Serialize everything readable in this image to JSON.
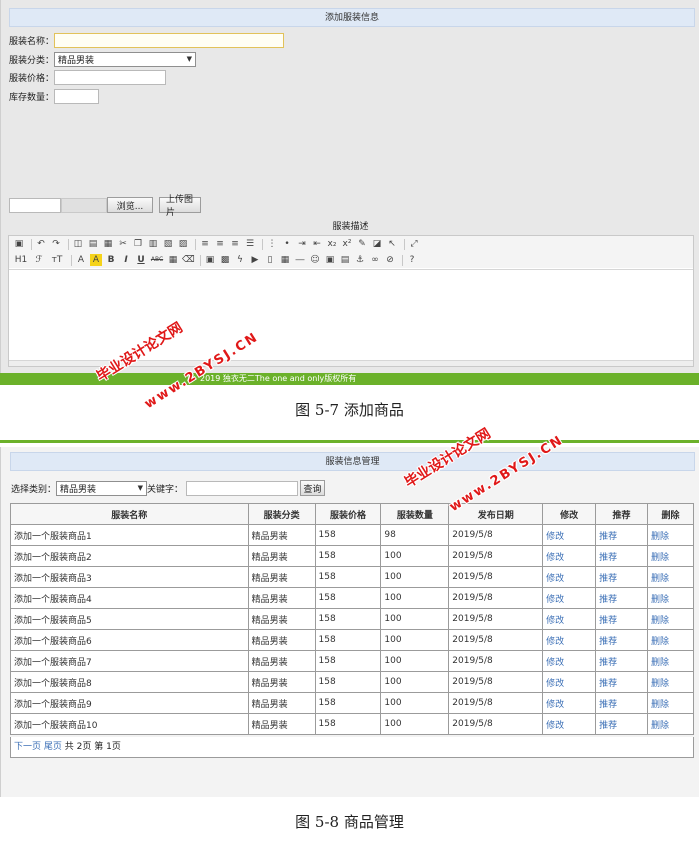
{
  "add_form": {
    "header": "添加服装信息",
    "name_label": "服装名称：",
    "category_label": "服装分类：",
    "category_value": "精品男装",
    "price_label": "服装价格：",
    "stock_label": "库存数量：",
    "browse_button": "浏览...",
    "upload_button": "上传图片",
    "description_label": "服装描述",
    "toolbar_row1": [
      "source-icon",
      "undo-icon",
      "redo-icon",
      "preview-icon",
      "print-icon",
      "template-icon",
      "cut-icon",
      "copy-icon",
      "paste-icon",
      "paste-text-icon",
      "paste-word-icon",
      "align-left-icon",
      "align-center-icon",
      "align-right-icon",
      "justify-icon",
      "ordered-list-icon",
      "unordered-list-icon",
      "indent-icon",
      "outdent-icon",
      "subscript-icon",
      "superscript-icon",
      "clear-format-icon",
      "select-all-icon",
      "fullscreen-icon"
    ],
    "toolbar_row2": [
      "heading-icon",
      "font-family-icon",
      "font-size-icon",
      "font-color-icon",
      "background-color-icon",
      "bold-icon",
      "italic-icon",
      "underline-icon",
      "strikethrough-icon",
      "line-height-icon",
      "remove-format-icon",
      "image-icon",
      "multi-image-icon",
      "flash-icon",
      "media-icon",
      "file-icon",
      "table-icon",
      "hr-icon",
      "emoticon-icon",
      "map-icon",
      "pagebreak-icon",
      "anchor-icon",
      "link-icon",
      "unlink-icon",
      "about-icon"
    ],
    "toolbar_glyphs_row2": {
      "heading": "H1",
      "font_family": "ℱ",
      "font_size": "тT",
      "font_color": "A",
      "bg_color": "A",
      "bold": "B",
      "italic": "I",
      "underline": "U",
      "strike": "ABC"
    }
  },
  "footer": {
    "copyright": "2019 独衣无二The one and only版权所有"
  },
  "captions": {
    "fig1": "图  5-7  添加商品",
    "fig2": "图  5-8  商品管理"
  },
  "manage": {
    "header": "服装信息管理",
    "filter_label": "选择类别：",
    "filter_value": "精品男装",
    "keyword_label": "关键字：",
    "query_button": "查询",
    "columns": [
      "服装名称",
      "服装分类",
      "服装价格",
      "服装数量",
      "发布日期",
      "修改",
      "推荐",
      "删除"
    ],
    "rows": [
      [
        "添加一个服装商品1",
        "精品男装",
        "158",
        "98",
        "2019/5/8",
        "修改",
        "推荐",
        "删除"
      ],
      [
        "添加一个服装商品2",
        "精品男装",
        "158",
        "100",
        "2019/5/8",
        "修改",
        "推荐",
        "删除"
      ],
      [
        "添加一个服装商品3",
        "精品男装",
        "158",
        "100",
        "2019/5/8",
        "修改",
        "推荐",
        "删除"
      ],
      [
        "添加一个服装商品4",
        "精品男装",
        "158",
        "100",
        "2019/5/8",
        "修改",
        "推荐",
        "删除"
      ],
      [
        "添加一个服装商品5",
        "精品男装",
        "158",
        "100",
        "2019/5/8",
        "修改",
        "推荐",
        "删除"
      ],
      [
        "添加一个服装商品6",
        "精品男装",
        "158",
        "100",
        "2019/5/8",
        "修改",
        "推荐",
        "删除"
      ],
      [
        "添加一个服装商品7",
        "精品男装",
        "158",
        "100",
        "2019/5/8",
        "修改",
        "推荐",
        "删除"
      ],
      [
        "添加一个服装商品8",
        "精品男装",
        "158",
        "100",
        "2019/5/8",
        "修改",
        "推荐",
        "删除"
      ],
      [
        "添加一个服装商品9",
        "精品男装",
        "158",
        "100",
        "2019/5/8",
        "修改",
        "推荐",
        "删除"
      ],
      [
        "添加一个服装商品10",
        "精品男装",
        "158",
        "100",
        "2019/5/8",
        "修改",
        "推荐",
        "删除"
      ]
    ],
    "pager": {
      "next": "下一页",
      "last": "尾页",
      "summary": "共 2页 第 1页"
    }
  },
  "watermarks": {
    "site_cn": "毕业设计论文网",
    "site_url": "www.2BYSJ.CN"
  },
  "colors": {
    "header_bg": "#dfe9f6",
    "panel_bg": "#e8e8e8",
    "footer_green": "#6bb12a",
    "link_blue": "#3b6fb6",
    "watermark_red": "#e01818"
  }
}
